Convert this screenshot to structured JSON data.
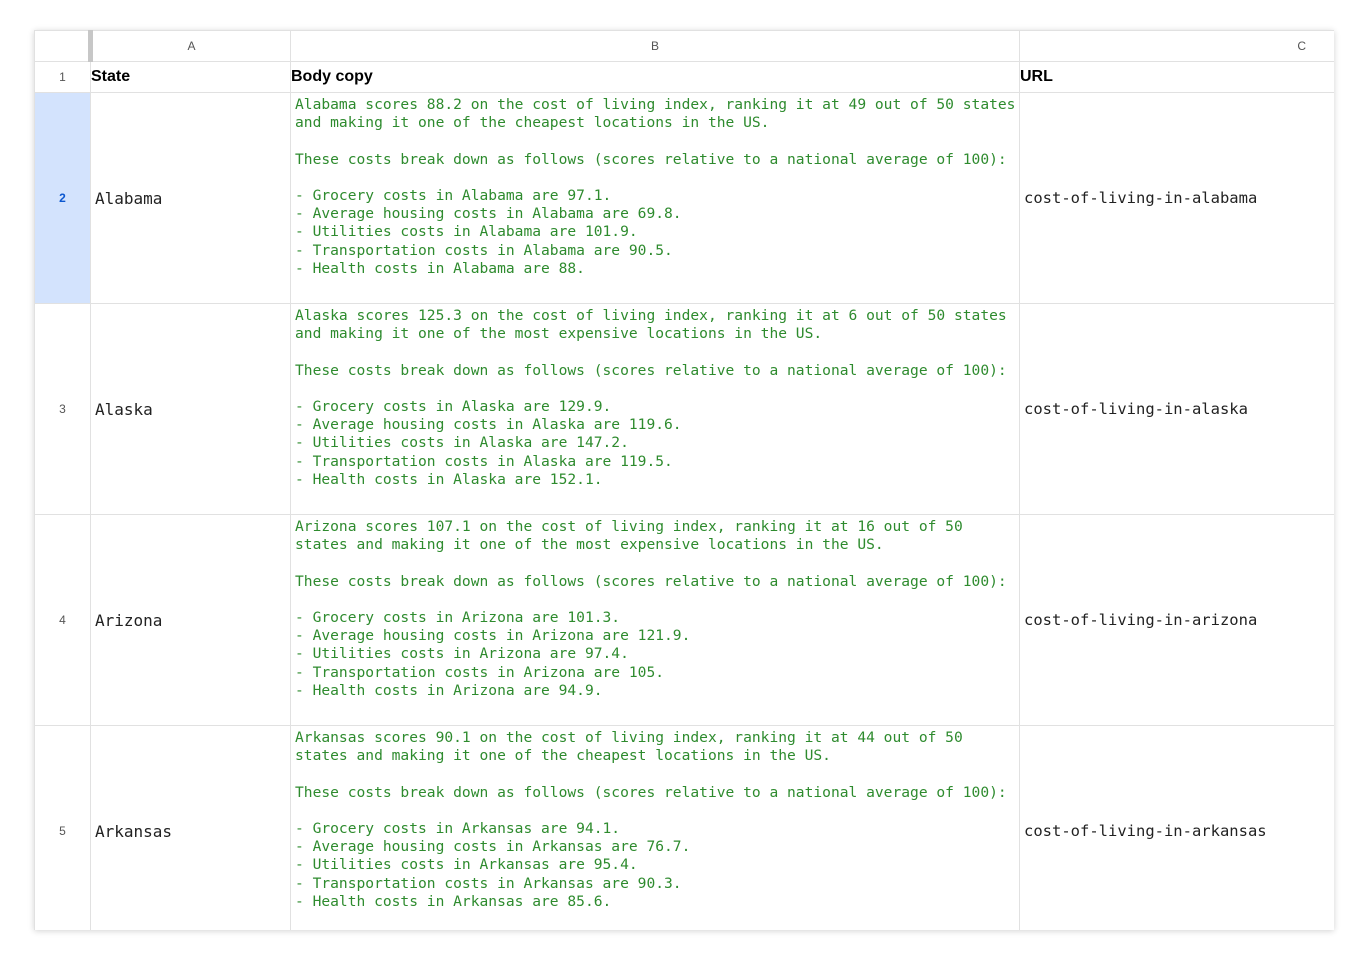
{
  "columns": {
    "a": "A",
    "b": "B",
    "c": "C"
  },
  "header_row": {
    "number": "1",
    "state": "State",
    "body_copy": "Body copy",
    "url": "URL"
  },
  "rows": [
    {
      "number": "2",
      "state": "Alabama",
      "body": "Alabama scores 88.2 on the cost of living index, ranking it at 49 out of 50 states and making it one of the cheapest locations in the US.\n\nThese costs break down as follows (scores relative to a national average of 100):\n\n- Grocery costs in Alabama are 97.1.\n- Average housing costs in Alabama are 69.8.\n- Utilities costs in Alabama are 101.9.\n- Transportation costs in Alabama are 90.5.\n- Health costs in Alabama are 88.",
      "url": "cost-of-living-in-alabama"
    },
    {
      "number": "3",
      "state": "Alaska",
      "body": "Alaska scores 125.3 on the cost of living index, ranking it at 6 out of 50 states and making it one of the most expensive locations in the US.\n\nThese costs break down as follows (scores relative to a national average of 100):\n\n- Grocery costs in Alaska are 129.9.\n- Average housing costs in Alaska are 119.6.\n- Utilities costs in Alaska are 147.2.\n- Transportation costs in Alaska are 119.5.\n- Health costs in Alaska are 152.1.",
      "url": "cost-of-living-in-alaska"
    },
    {
      "number": "4",
      "state": "Arizona",
      "body": "Arizona scores 107.1 on the cost of living index, ranking it at 16 out of 50 states and making it one of the most expensive locations in the US.\n\nThese costs break down as follows (scores relative to a national average of 100):\n\n- Grocery costs in Arizona are 101.3.\n- Average housing costs in Arizona are 121.9.\n- Utilities costs in Arizona are 97.4.\n- Transportation costs in Arizona are 105.\n- Health costs in Arizona are 94.9.",
      "url": "cost-of-living-in-arizona"
    },
    {
      "number": "5",
      "state": "Arkansas",
      "body": "Arkansas scores 90.1 on the cost of living index, ranking it at 44 out of 50 states and making it one of the cheapest locations in the US.\n\nThese costs break down as follows (scores relative to a national average of 100):\n\n- Grocery costs in Arkansas are 94.1.\n- Average housing costs in Arkansas are 76.7.\n- Utilities costs in Arkansas are 95.4.\n- Transportation costs in Arkansas are 90.3.\n- Health costs in Arkansas are 85.6.",
      "url": "cost-of-living-in-arkansas"
    }
  ],
  "selected_row": "2",
  "colors": {
    "body_text": "#2e8b2e",
    "selected_row_header": "#d3e3fd"
  }
}
